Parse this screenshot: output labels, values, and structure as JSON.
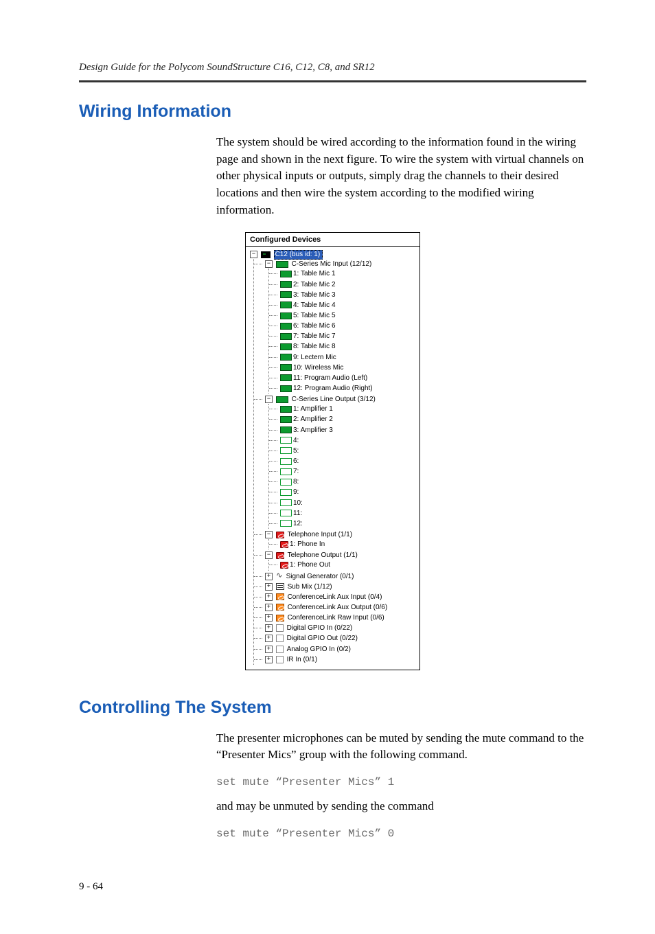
{
  "header": {
    "running_title": "Design Guide for the Polycom SoundStructure C16, C12, C8, and SR12"
  },
  "section1": {
    "heading": "Wiring Information",
    "para1": "The system should be wired according to the information found in the wiring page and shown in the next figure. To wire the system with virtual channels on other physical inputs or outputs, simply drag the channels to their desired locations and then wire the system according to the modified wiring information."
  },
  "tree": {
    "panel_title": "Configured Devices",
    "root": "C12 (bus id: 1)",
    "mic_group": "C-Series Mic Input (12/12)",
    "mics": [
      "1: Table Mic 1",
      "2: Table Mic 2",
      "3: Table Mic 3",
      "4: Table Mic 4",
      "5: Table Mic 5",
      "6: Table Mic 6",
      "7: Table Mic 7",
      "8: Table Mic 8",
      "9: Lectern Mic",
      "10: Wireless Mic",
      "11: Program Audio (Left)",
      "12: Program Audio (Right)"
    ],
    "line_group": "C-Series Line Output (3/12)",
    "lines": [
      "1: Amplifier 1",
      "2: Amplifier 2",
      "3: Amplifier 3",
      "4:",
      "5:",
      "6:",
      "7:",
      "8:",
      "9:",
      "10:",
      "11:",
      "12:"
    ],
    "tel_in_group": "Telephone Input (1/1)",
    "tel_in": "1: Phone In",
    "tel_out_group": "Telephone Output (1/1)",
    "tel_out": "1: Phone Out",
    "siggen": "Signal Generator (0/1)",
    "submix": "Sub Mix (1/12)",
    "confaux_in": "ConferenceLink Aux Input (0/4)",
    "confaux_out": "ConferenceLink Aux Output (0/6)",
    "confraw_in": "ConferenceLink Raw Input (0/6)",
    "gpio_in": "Digital GPIO In (0/22)",
    "gpio_out": "Digital GPIO Out (0/22)",
    "analog_gpio": "Analog GPIO In (0/2)",
    "ir_in": "IR In (0/1)"
  },
  "section2": {
    "heading": "Controlling The System",
    "para1": "The presenter microphones can be muted by sending the mute command to the “Presenter Mics” group with the following command.",
    "cmd1": "set mute “Presenter Mics” 1",
    "para2": "and may be unmuted by sending the command",
    "cmd2": "set mute “Presenter Mics” 0"
  },
  "footer": {
    "page_number": "9 - 64"
  }
}
